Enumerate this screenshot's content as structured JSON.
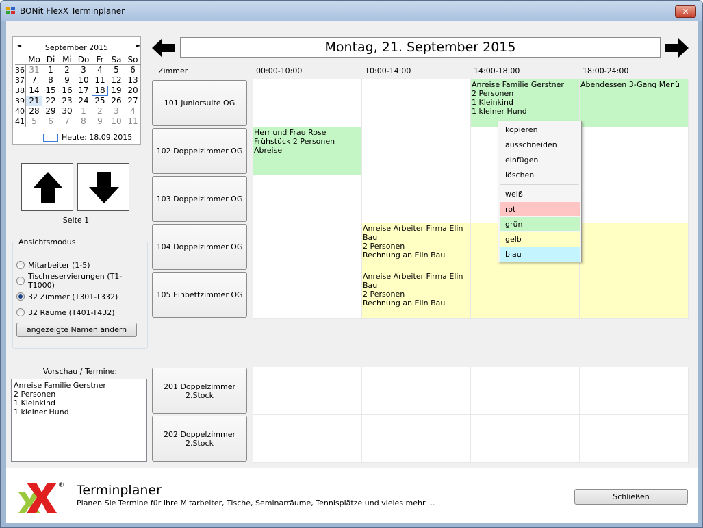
{
  "window": {
    "title": "BONit FlexX Terminplaner",
    "close_glyph": "✕"
  },
  "calendar": {
    "month_title": "September 2015",
    "prev_glyph": "◄",
    "next_glyph": "►",
    "weekdays": [
      "Mo",
      "Di",
      "Mi",
      "Do",
      "Fr",
      "Sa",
      "So"
    ],
    "weeks": [
      {
        "wk": "36",
        "days": [
          "31",
          "1",
          "2",
          "3",
          "4",
          "5",
          "6"
        ]
      },
      {
        "wk": "37",
        "days": [
          "7",
          "8",
          "9",
          "10",
          "11",
          "12",
          "13"
        ]
      },
      {
        "wk": "38",
        "days": [
          "14",
          "15",
          "16",
          "17",
          "18",
          "19",
          "20"
        ]
      },
      {
        "wk": "39",
        "days": [
          "21",
          "22",
          "23",
          "24",
          "25",
          "26",
          "27"
        ]
      },
      {
        "wk": "40",
        "days": [
          "28",
          "29",
          "30",
          "1",
          "2",
          "3",
          "4"
        ]
      },
      {
        "wk": "41",
        "days": [
          "5",
          "6",
          "7",
          "8",
          "9",
          "10",
          "11"
        ]
      }
    ],
    "today_label": "Heute: 18.09.2015"
  },
  "paging": {
    "page_label": "Seite 1"
  },
  "view_mode": {
    "legend": "Ansichtsmodus",
    "options": [
      {
        "label": "Mitarbeiter (1-5)",
        "checked": false
      },
      {
        "label": "Tischreservierungen (T1-T1000)",
        "checked": false
      },
      {
        "label": "32 Zimmer (T301-T332)",
        "checked": true
      },
      {
        "label": "32 Räume (T401-T432)",
        "checked": false
      }
    ],
    "rename_button": "angezeigte Namen ändern"
  },
  "preview": {
    "label": "Vorschau / Termine:",
    "lines": [
      "Anreise Familie Gerstner",
      "2 Personen",
      "1 Kleinkind",
      "1 kleiner Hund"
    ]
  },
  "schedule": {
    "date": "Montag, 21. September 2015",
    "room_header": "Zimmer",
    "columns": [
      "00:00-10:00",
      "10:00-14:00",
      "14:00-18:00",
      "18:00-24:00"
    ],
    "rooms_top": [
      {
        "name": "101 Juniorsuite OG",
        "cells": [
          {
            "text": "",
            "color": "#ffffff"
          },
          {
            "text": "",
            "color": "#ffffff"
          },
          {
            "text": "Anreise Familie Gerstner\n2 Personen\n1 Kleinkind\n1 kleiner Hund",
            "color": "#c4f5c4"
          },
          {
            "text": "Abendessen 3-Gang Menü",
            "color": "#c4f5c4"
          }
        ]
      },
      {
        "name": "102 Doppelzimmer OG",
        "cells": [
          {
            "text": "Herr und Frau Rose\nFrühstück 2 Personen\nAbreise",
            "color": "#c4f5c4"
          },
          {
            "text": "",
            "color": "#ffffff"
          },
          {
            "text": "",
            "color": "#ffffff"
          },
          {
            "text": "",
            "color": "#ffffff"
          }
        ]
      },
      {
        "name": "103 Doppelzimmer OG",
        "cells": [
          {
            "text": "",
            "color": "#ffffff"
          },
          {
            "text": "",
            "color": "#ffffff"
          },
          {
            "text": "",
            "color": "#ffffff"
          },
          {
            "text": "",
            "color": "#ffffff"
          }
        ]
      },
      {
        "name": "104 Doppelzimmer OG",
        "cells": [
          {
            "text": "",
            "color": "#ffffff"
          },
          {
            "text": "Anreise Arbeiter Firma Elin Bau\n2 Personen\nRechnung an Elin Bau",
            "color": "#ffffc4"
          },
          {
            "text": "",
            "color": "#ffffc4"
          },
          {
            "text": "",
            "color": "#ffffc4"
          }
        ]
      },
      {
        "name": "105 Einbettzimmer OG",
        "cells": [
          {
            "text": "",
            "color": "#ffffff"
          },
          {
            "text": "Anreise Arbeiter Firma Elin Bau\n2 Personen\nRechnung an Elin Bau",
            "color": "#ffffc4"
          },
          {
            "text": "",
            "color": "#ffffc4"
          },
          {
            "text": "",
            "color": "#ffffc4"
          }
        ]
      }
    ],
    "rooms_bottom": [
      {
        "name": "201 Doppelzimmer\n2.Stock",
        "cells": [
          {
            "text": "",
            "color": "#ffffff"
          },
          {
            "text": "",
            "color": "#ffffff"
          },
          {
            "text": "",
            "color": "#ffffff"
          },
          {
            "text": "",
            "color": "#ffffff"
          }
        ]
      },
      {
        "name": "202 Doppelzimmer\n2.Stock",
        "cells": [
          {
            "text": "",
            "color": "#ffffff"
          },
          {
            "text": "",
            "color": "#ffffff"
          },
          {
            "text": "",
            "color": "#ffffff"
          },
          {
            "text": "",
            "color": "#ffffff"
          }
        ]
      }
    ]
  },
  "context_menu": {
    "actions": [
      "kopieren",
      "ausschneiden",
      "einfügen",
      "löschen"
    ],
    "colors": [
      {
        "label": "weiß",
        "color": "#f5f5f5"
      },
      {
        "label": "rot",
        "color": "#ffc4c4"
      },
      {
        "label": "grün",
        "color": "#c4f5c4"
      },
      {
        "label": "gelb",
        "color": "#ffffc4"
      },
      {
        "label": "blau",
        "color": "#c4f5ff"
      }
    ]
  },
  "footer": {
    "title": "Terminplaner",
    "subtitle": "Planen Sie Termine für Ihre Mitarbeiter, Tische, Seminarräume, Tennisplätze und vieles mehr ...",
    "close_button": "Schließen",
    "logo_trademark": "®"
  }
}
